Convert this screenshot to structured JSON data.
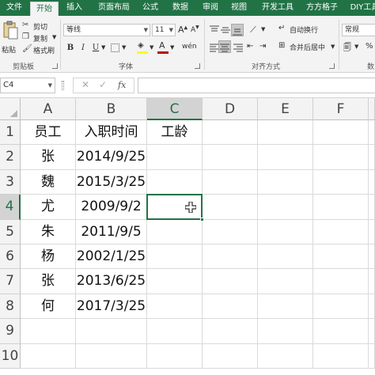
{
  "tabs": [
    "文件",
    "开始",
    "插入",
    "页面布局",
    "公式",
    "数据",
    "审阅",
    "视图",
    "开发工具",
    "方方格子",
    "DIY工具"
  ],
  "active_tab": "开始",
  "ribbon": {
    "paste_label": "粘贴",
    "cut_label": "剪切",
    "copy_label": "复制",
    "format_painter_label": "格式刷",
    "clipboard_group": "剪贴板",
    "font_name": "等线",
    "font_size": "11",
    "bold": "B",
    "italic": "I",
    "underline": "U",
    "font_group": "字体",
    "wrap_text_label": "自动换行",
    "merge_center_label": "合并后居中",
    "alignment_group": "对齐方式",
    "number_format": "常规",
    "number_group_partial": "数"
  },
  "formula_bar": {
    "name_box": "C4",
    "fx": "fx",
    "formula": ""
  },
  "columns": [
    "A",
    "B",
    "C",
    "D",
    "E",
    "F"
  ],
  "rows": [
    "1",
    "2",
    "3",
    "4",
    "5",
    "6",
    "7",
    "8",
    "9",
    "10"
  ],
  "selected_cell": "C4",
  "cells": {
    "header": [
      "员工",
      "入职时间",
      "工龄"
    ],
    "data": [
      [
        "张",
        "2014/9/25"
      ],
      [
        "魏",
        "2015/3/25"
      ],
      [
        "尤",
        "2009/9/2"
      ],
      [
        "朱",
        "2011/9/5"
      ],
      [
        "杨",
        "2002/1/25"
      ],
      [
        "张",
        "2013/6/25"
      ],
      [
        "何",
        "2017/3/25"
      ]
    ]
  },
  "colors": {
    "accent": "#217346",
    "ribbon_bg": "#f3f3f3",
    "font_color": "#c00000",
    "highlight": "#ffff00"
  }
}
